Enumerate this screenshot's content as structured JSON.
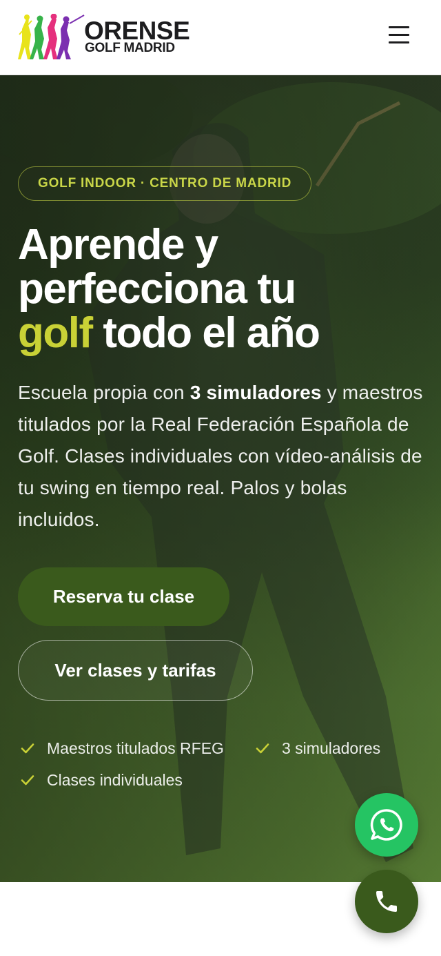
{
  "header": {
    "logo_title": "ORENSE",
    "logo_subtitle": "GOLF MADRID",
    "menu_icon": "hamburger-menu-icon"
  },
  "hero": {
    "badge": "GOLF INDOOR · CENTRO DE MADRID",
    "headline_line1": "Aprende y",
    "headline_line2": "perfecciona tu",
    "headline_accent": "golf",
    "headline_rest": " todo el año",
    "lead_before": "Escuela propia con ",
    "lead_bold": "3 simuladores",
    "lead_after": " y maestros titulados por la Real Federación Española de Golf. Clases individuales con vídeo-análisis de tu swing en tiempo real. Palos y bolas incluidos.",
    "primary_button": "Reserva tu clase",
    "secondary_button": "Ver clases y tarifas",
    "features": [
      "Maestros titulados RFEG",
      "3 simuladores",
      "Clases individuales"
    ]
  },
  "floating": {
    "whatsapp_icon": "whatsapp-icon",
    "phone_icon": "phone-icon"
  },
  "colors": {
    "accent_lime": "#c9d136",
    "brand_green": "#3a5a1c",
    "whatsapp_green": "#25c463"
  }
}
